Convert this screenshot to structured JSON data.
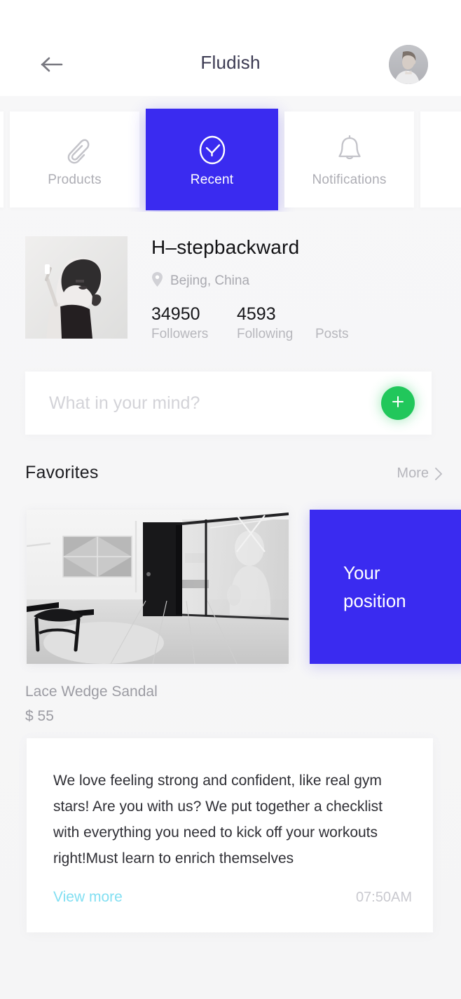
{
  "header": {
    "title": "Fludish",
    "back_icon": "arrow-left-icon",
    "avatar_icon": "user-avatar-photo"
  },
  "tabs": [
    {
      "label": "Products",
      "icon": "paperclip-icon",
      "active": false
    },
    {
      "label": "Recent",
      "icon": "clock-check-icon",
      "active": true
    },
    {
      "label": "Notifications",
      "icon": "bell-icon",
      "active": false
    }
  ],
  "profile": {
    "name": "H–stepbackward",
    "location": "Bejing, China",
    "location_icon": "map-pin-icon",
    "photo_icon": "profile-photo",
    "stats": [
      {
        "value": "34950",
        "label": "Followers"
      },
      {
        "value": "4593",
        "label": "Following"
      },
      {
        "value": "",
        "label": "Posts"
      }
    ]
  },
  "composer": {
    "placeholder": "What in your mind?",
    "value": "",
    "add_icon": "plus-icon"
  },
  "favorites": {
    "title": "Favorites",
    "more_label": "More",
    "more_icon": "chevron-right-icon",
    "photo_icon": "interior-office-photo",
    "promo_text": "Your\nposition",
    "product_name": "Lace Wedge Sandal",
    "product_price": "$ 55"
  },
  "post": {
    "body": "We love feeling strong and confident, like real gym stars! Are you with us? We put together a checklist with everything you need to kick off your workouts right!Must learn to enrich themselves",
    "link_label": "View more",
    "time": "07:50AM"
  },
  "colors": {
    "accent_blue": "#3a2bf0",
    "accent_green": "#21c75b",
    "link_blue": "#82dff2",
    "page_bg": "#f6f6f7"
  }
}
